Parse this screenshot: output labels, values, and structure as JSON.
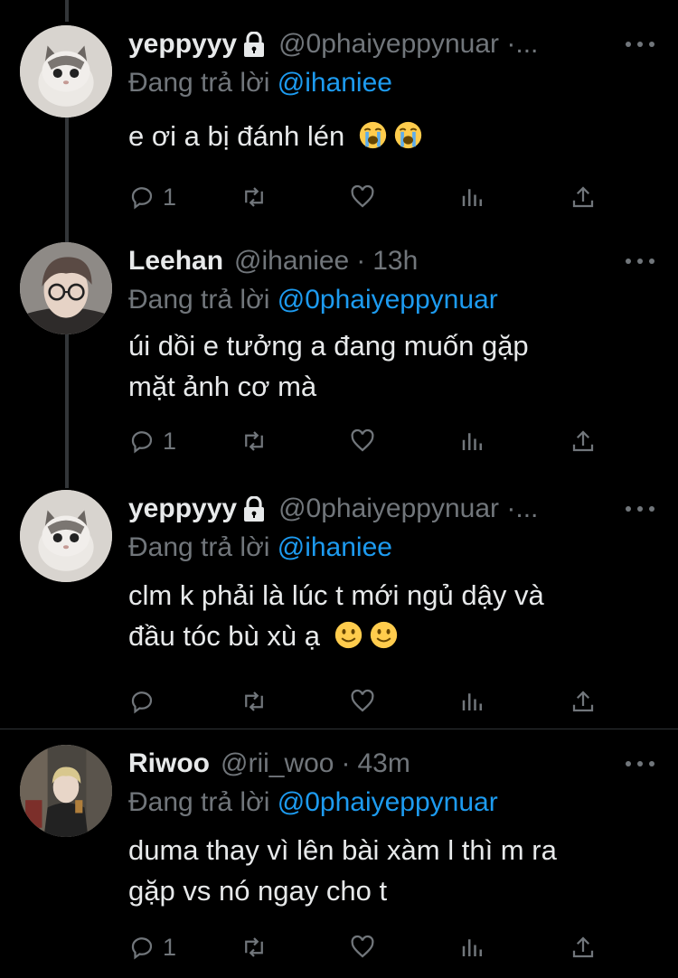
{
  "colors": {
    "background": "#000000",
    "text": "#e7e9ea",
    "muted": "#71767b",
    "accent": "#1d9bf0",
    "thread_line": "#333639"
  },
  "tweets": [
    {
      "name": "yeppyyy",
      "protected": true,
      "handle": "@0phaiyeppynuar ·...",
      "time": "",
      "reply_prefix": "Đang trả lời",
      "reply_to": "@ihaniee",
      "text_lines": [
        "e ơi a bị đánh lén"
      ],
      "emojis": [
        "loudly-crying-face-emoji",
        "loudly-crying-face-emoji"
      ],
      "reply_count": "1",
      "avatar": "kitten-avatar"
    },
    {
      "name": "Leehan",
      "protected": false,
      "handle": "@ihaniee",
      "time": "13h",
      "reply_prefix": "Đang trả lời",
      "reply_to": "@0phaiyeppynuar",
      "text_lines": [
        "úi dồi e tưởng a đang muốn gặp",
        "mặt ảnh cơ mà"
      ],
      "emojis": [],
      "reply_count": "1",
      "avatar": "person-glasses-avatar"
    },
    {
      "name": "yeppyyy",
      "protected": true,
      "handle": "@0phaiyeppynuar ·...",
      "time": "",
      "reply_prefix": "Đang trả lời",
      "reply_to": "@ihaniee",
      "text_lines": [
        "clm k phải là lúc t mới ngủ dậy và",
        "đầu tóc bù xù ạ"
      ],
      "emojis": [
        "slightly-smiling-face-emoji",
        "slightly-smiling-face-emoji"
      ],
      "reply_count": "",
      "avatar": "kitten-avatar"
    },
    {
      "name": "Riwoo",
      "protected": false,
      "handle": "@rii_woo",
      "time": "43m",
      "reply_prefix": "Đang trả lời",
      "reply_to": "@0phaiyeppynuar",
      "text_lines": [
        "duma thay vì lên bài xàm l thì m ra",
        "gặp vs nó ngay cho t"
      ],
      "emojis": [],
      "reply_count": "1",
      "avatar": "person-street-avatar"
    }
  ]
}
